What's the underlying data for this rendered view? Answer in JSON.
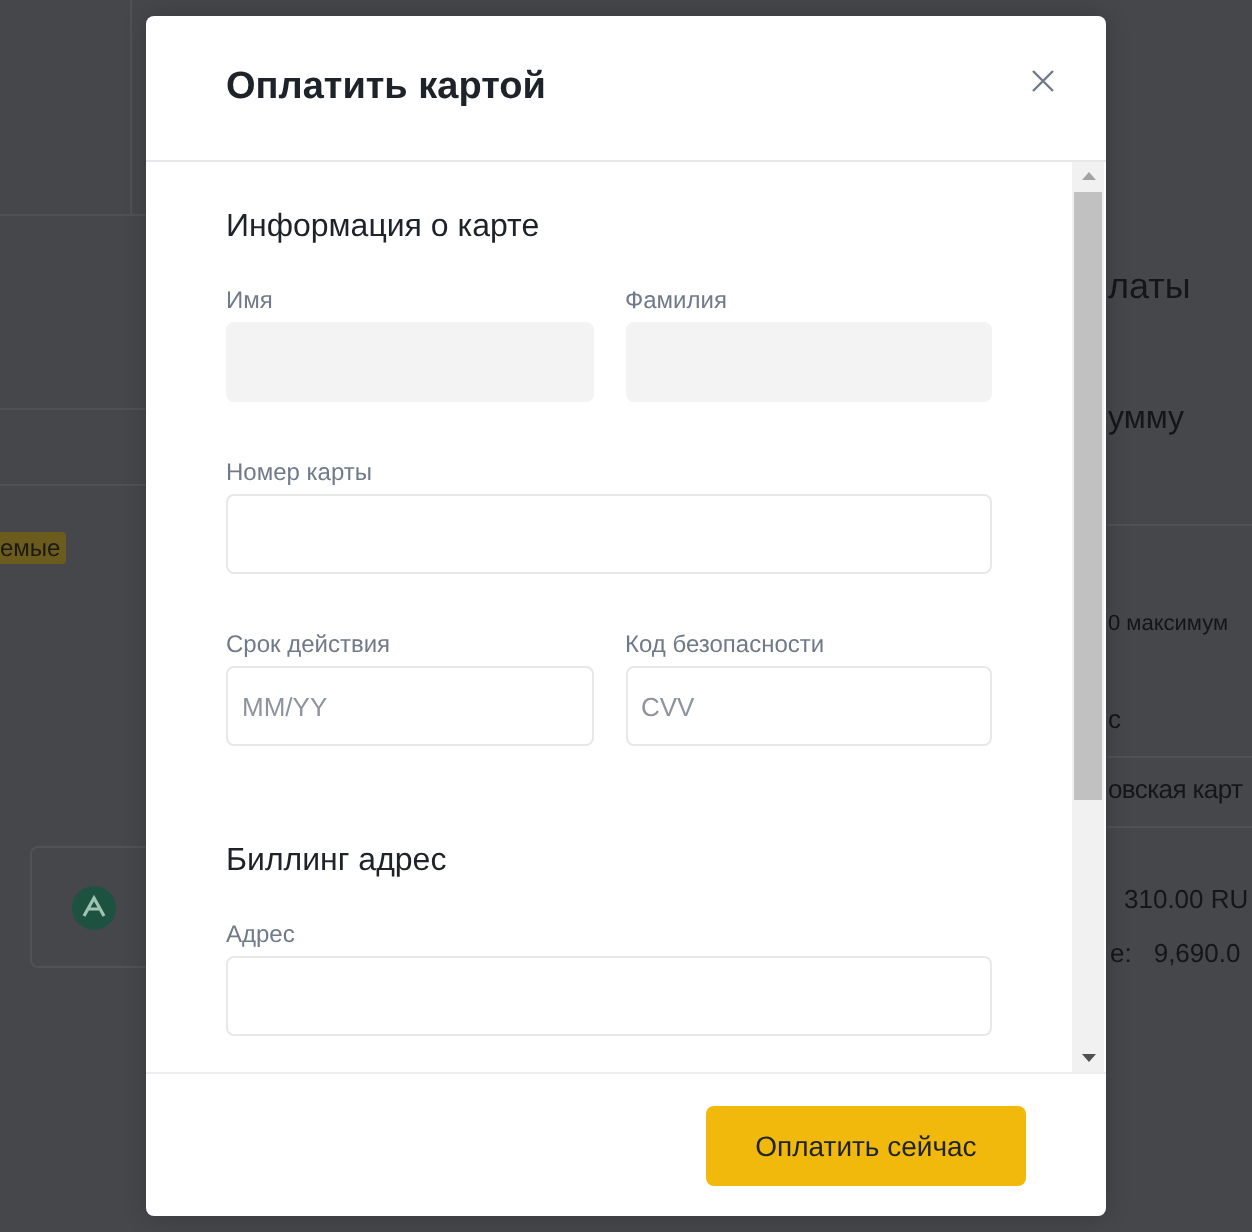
{
  "background_page": {
    "tag": "емые",
    "right_column": [
      {
        "kind": "heading",
        "text": "латы"
      },
      {
        "kind": "subheading",
        "text": "умму"
      },
      {
        "kind": "note",
        "text": "0 максимум"
      },
      {
        "kind": "item",
        "text": "с"
      },
      {
        "kind": "item",
        "text": "овская карт"
      },
      {
        "kind": "amount",
        "text": "310.00 RU"
      },
      {
        "kind": "pair",
        "label": "е:",
        "value": "9,690.0"
      }
    ]
  },
  "dialog": {
    "title": "Оплатить картой",
    "sections": [
      {
        "title": "Информация о карте",
        "rows": [
          [
            {
              "label": "Имя",
              "disabled": true
            },
            {
              "label": "Фамилия",
              "disabled": true
            }
          ],
          [
            {
              "label": "Номер карты",
              "disabled": false
            }
          ],
          [
            {
              "label": "Срок действия",
              "placeholder": "MM/YY",
              "disabled": false
            },
            {
              "label": "Код безопасности",
              "placeholder": "CVV",
              "disabled": false
            }
          ]
        ]
      },
      {
        "title": "Биллинг адрес",
        "rows": [
          [
            {
              "label": "Адрес",
              "disabled": false
            }
          ]
        ]
      }
    ],
    "submit_button": "Оплатить сейчас"
  }
}
